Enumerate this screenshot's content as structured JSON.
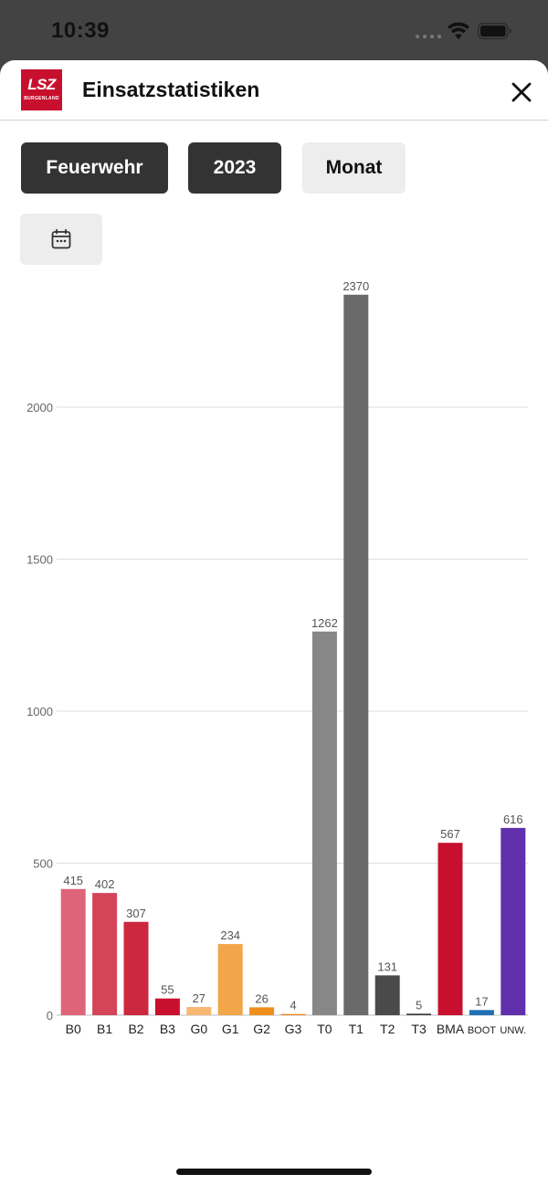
{
  "status_bar": {
    "time": "10:39"
  },
  "header": {
    "title": "Einsatzstatistiken",
    "logo_text": "LSZ",
    "logo_subtext": "BURGENLAND"
  },
  "filters": {
    "organization": "Feuerwehr",
    "year": "2023",
    "period": "Monat"
  },
  "icons": {
    "calendar": "calendar-icon",
    "close": "close-icon",
    "wifi": "wifi-icon",
    "battery": "battery-icon"
  },
  "chart_data": {
    "type": "bar",
    "categories": [
      "B0",
      "B1",
      "B2",
      "B3",
      "G0",
      "G1",
      "G2",
      "G3",
      "T0",
      "T1",
      "T2",
      "T3",
      "BMA",
      "BOOT",
      "UNW."
    ],
    "values": [
      415,
      402,
      307,
      55,
      27,
      234,
      26,
      4,
      1262,
      2370,
      131,
      5,
      567,
      17,
      616
    ],
    "colors": [
      "#de6579",
      "#d44559",
      "#cc2840",
      "#c8102e",
      "#f7b874",
      "#f2a549",
      "#ee8f1d",
      "#eb8a1e",
      "#878787",
      "#6a6a6a",
      "#4a4a4a",
      "#3d3d3d",
      "#c8102e",
      "#1f6fb5",
      "#6030ad"
    ],
    "ylim": [
      0,
      2500
    ],
    "yticks": [
      0,
      500,
      1000,
      1500,
      2000
    ],
    "grid": true,
    "title": "",
    "xlabel": "",
    "ylabel": ""
  }
}
